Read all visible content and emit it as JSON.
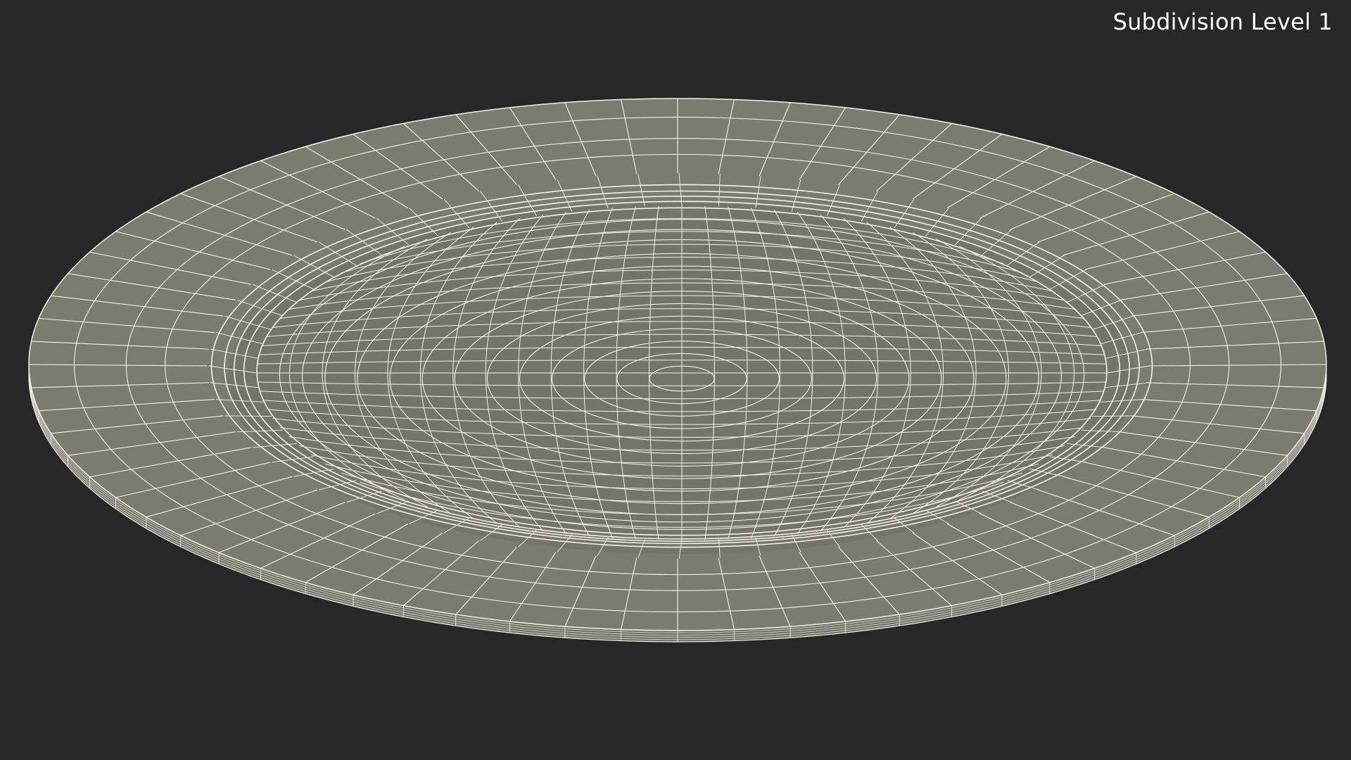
{
  "viewport": {
    "subdivision_label": "Subdivision Level 1"
  },
  "model": {
    "name": "plate",
    "render_mode": "wireframe on shaded",
    "colors": {
      "background": "#272727",
      "surface": "#7b7c70",
      "surface_inner": "#74756a",
      "surface_rim": "#6f7066",
      "wire": "#f2f1e6"
    }
  }
}
